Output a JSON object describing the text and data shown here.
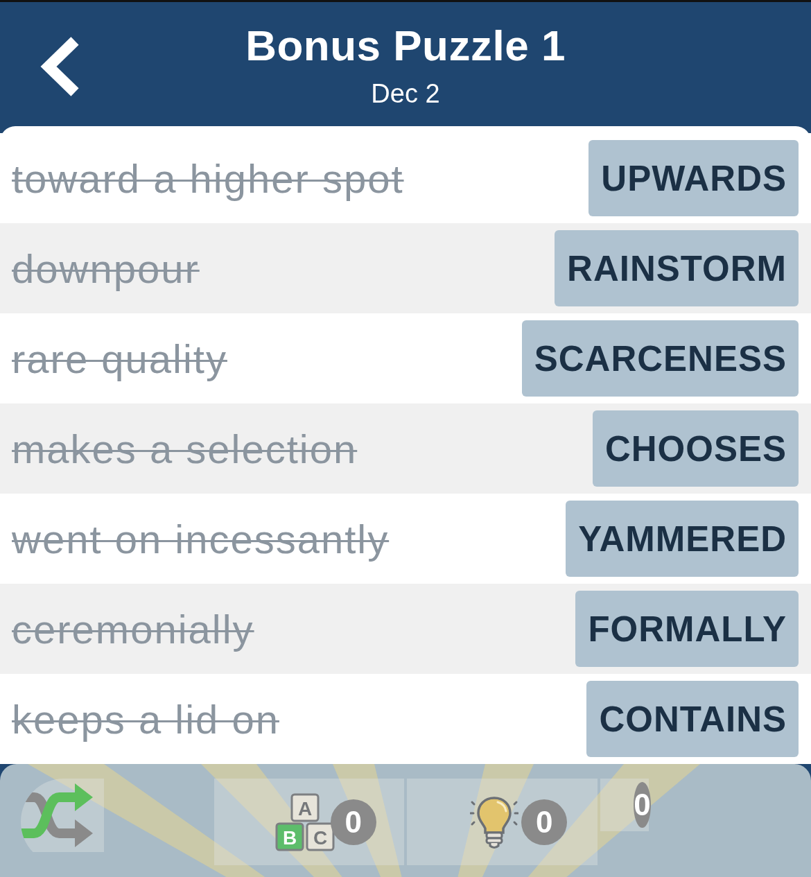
{
  "header": {
    "title": "Bonus Puzzle 1",
    "subtitle": "Dec 2"
  },
  "clues": [
    {
      "clue": "toward a higher spot",
      "answer": "UPWARDS",
      "solved": true
    },
    {
      "clue": "downpour",
      "answer": "RAINSTORM",
      "solved": true
    },
    {
      "clue": "rare quality",
      "answer": "SCARCENESS",
      "solved": true
    },
    {
      "clue": "makes a selection",
      "answer": "CHOOSES",
      "solved": true
    },
    {
      "clue": "went on incessantly",
      "answer": "YAMMERED",
      "solved": true
    },
    {
      "clue": "ceremonially",
      "answer": "FORMALLY",
      "solved": true
    },
    {
      "clue": "keeps a lid on",
      "answer": "CONTAINS",
      "solved": true
    }
  ],
  "toolbar": [
    {
      "kind": "shuffle"
    },
    {
      "kind": "letters",
      "blocks": [
        "A",
        "B",
        "C"
      ],
      "count": "0"
    },
    {
      "kind": "hint",
      "count": "0"
    },
    {
      "kind": "target",
      "count": "0"
    }
  ]
}
